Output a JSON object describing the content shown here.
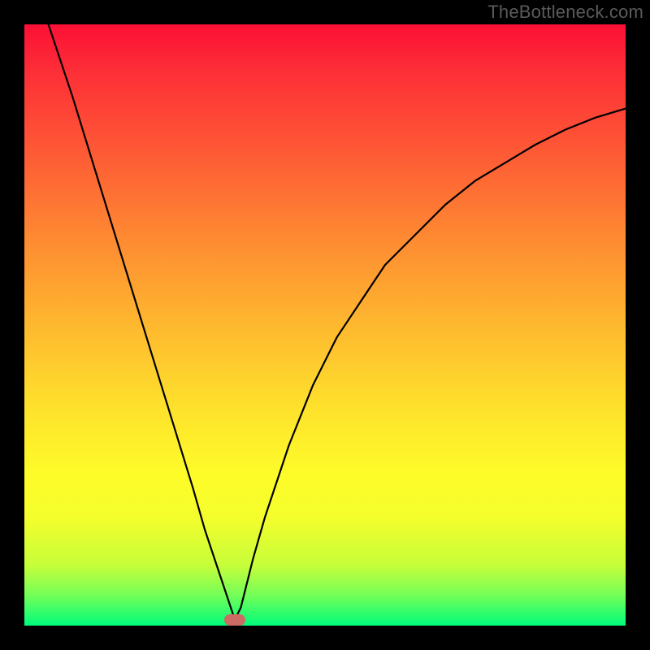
{
  "watermark": "TheBottleneck.com",
  "chart_data": {
    "type": "line",
    "title": "",
    "xlabel": "",
    "ylabel": "",
    "xlim": [
      0,
      100
    ],
    "ylim": [
      0,
      100
    ],
    "grid": false,
    "legend": false,
    "series": [
      {
        "name": "bottleneck-curve",
        "x": [
          4,
          8,
          12,
          16,
          20,
          24,
          28,
          30,
          32,
          34,
          35,
          36,
          38,
          40,
          44,
          48,
          52,
          56,
          60,
          65,
          70,
          75,
          80,
          85,
          90,
          95,
          100
        ],
        "y": [
          100,
          88,
          75,
          62,
          49,
          36,
          23,
          16,
          10,
          4,
          1,
          3,
          11,
          18,
          30,
          40,
          48,
          54,
          60,
          65,
          70,
          74,
          77,
          80,
          82.5,
          84.5,
          86
        ]
      }
    ],
    "marker": {
      "x": 35,
      "y": 1,
      "color": "#cc6a63"
    },
    "gradient_stops": [
      {
        "pos": 0,
        "color": "#fb1036"
      },
      {
        "pos": 8,
        "color": "#fd2f37"
      },
      {
        "pos": 22,
        "color": "#fe5c35"
      },
      {
        "pos": 36,
        "color": "#fe8b32"
      },
      {
        "pos": 50,
        "color": "#feb82f"
      },
      {
        "pos": 64,
        "color": "#fee22c"
      },
      {
        "pos": 75,
        "color": "#fdfc29"
      },
      {
        "pos": 82,
        "color": "#f4fe2c"
      },
      {
        "pos": 90,
        "color": "#c6fe3a"
      },
      {
        "pos": 95,
        "color": "#72fe58"
      },
      {
        "pos": 100,
        "color": "#00fc7b"
      }
    ]
  }
}
